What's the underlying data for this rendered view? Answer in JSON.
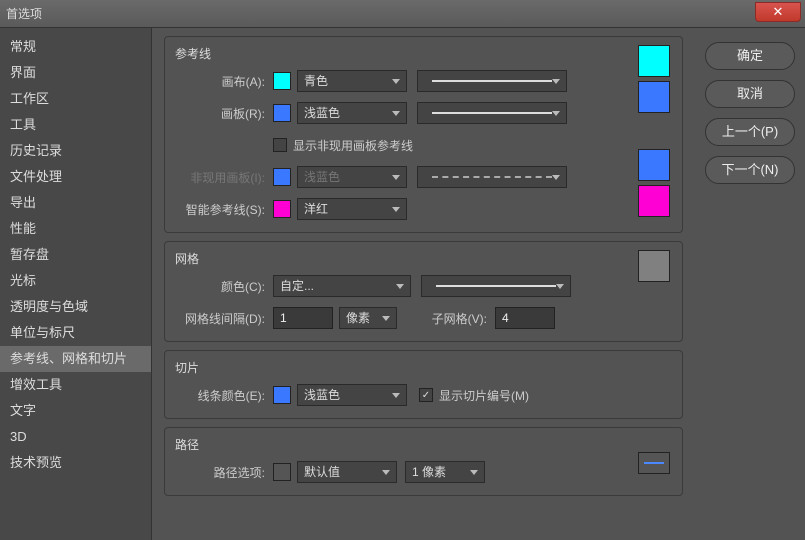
{
  "window": {
    "title": "首选项"
  },
  "sidebar": {
    "items": [
      {
        "label": "常规"
      },
      {
        "label": "界面"
      },
      {
        "label": "工作区"
      },
      {
        "label": "工具"
      },
      {
        "label": "历史记录"
      },
      {
        "label": "文件处理"
      },
      {
        "label": "导出"
      },
      {
        "label": "性能"
      },
      {
        "label": "暂存盘"
      },
      {
        "label": "光标"
      },
      {
        "label": "透明度与色域"
      },
      {
        "label": "单位与标尺"
      },
      {
        "label": "参考线、网格和切片"
      },
      {
        "label": "增效工具"
      },
      {
        "label": "文字"
      },
      {
        "label": "3D"
      },
      {
        "label": "技术预览"
      }
    ],
    "activeIndex": 12
  },
  "buttons": {
    "ok": "确定",
    "cancel": "取消",
    "prev": "上一个(P)",
    "next": "下一个(N)"
  },
  "guides": {
    "title": "参考线",
    "canvas_label": "画布(A):",
    "canvas_value": "青色",
    "canvas_color": "#00ffff",
    "artboard_label": "画板(R):",
    "artboard_value": "浅蓝色",
    "artboard_color": "#3a78ff",
    "show_inactive_label": "显示非现用画板参考线",
    "show_inactive_checked": false,
    "inactive_label": "非现用画板(I):",
    "inactive_value": "浅蓝色",
    "inactive_color": "#3a78ff",
    "smart_label": "智能参考线(S):",
    "smart_value": "洋红",
    "smart_color": "#ff00d4"
  },
  "grid": {
    "title": "网格",
    "color_label": "颜色(C):",
    "color_value": "自定...",
    "color_swatch": "#808080",
    "gridline_label": "网格线间隔(D):",
    "gridline_value": "1",
    "gridline_unit": "像素",
    "subdiv_label": "子网格(V):",
    "subdiv_value": "4"
  },
  "slices": {
    "title": "切片",
    "color_label": "线条颜色(E):",
    "color_value": "浅蓝色",
    "color_swatch": "#3a78ff",
    "show_numbers_label": "显示切片编号(M)",
    "show_numbers_checked": true
  },
  "paths": {
    "title": "路径",
    "options_label": "路径选项:",
    "options_value": "默认值",
    "thickness": "1 像素"
  }
}
